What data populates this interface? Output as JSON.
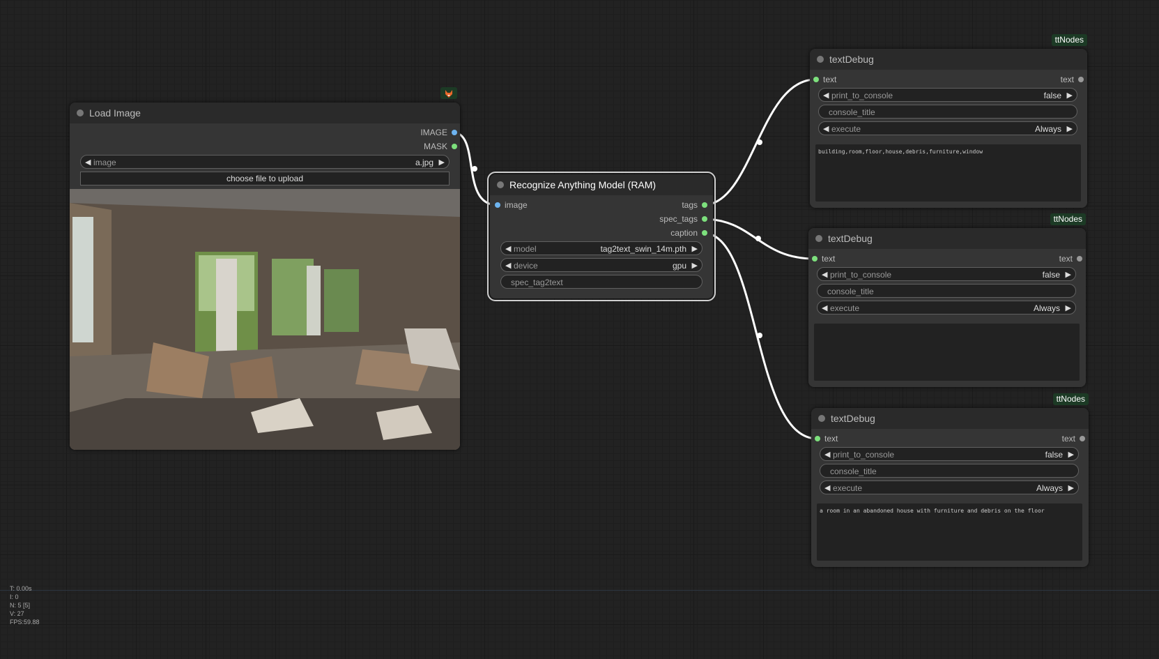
{
  "load_image": {
    "title": "Load Image",
    "outputs": [
      "IMAGE",
      "MASK"
    ],
    "image_widget": {
      "name": "image",
      "value": "a.jpg"
    },
    "upload_label": "choose file to upload",
    "badge_icon": "fox-icon"
  },
  "ram": {
    "title": "Recognize Anything Model (RAM)",
    "input": "image",
    "outputs": [
      "tags",
      "spec_tags",
      "caption"
    ],
    "model": {
      "name": "model",
      "value": "tag2text_swin_14m.pth"
    },
    "device": {
      "name": "device",
      "value": "gpu"
    },
    "spec_text": "spec_tag2text"
  },
  "debug_nodes": [
    {
      "badge": "ttNodes",
      "title": "textDebug",
      "input": "text",
      "output": "text",
      "print_name": "print_to_console",
      "print_value": "false",
      "console_title": "console_title",
      "execute_name": "execute",
      "execute_value": "Always",
      "text": "building,room,floor,house,debris,furniture,window"
    },
    {
      "badge": "ttNodes",
      "title": "textDebug",
      "input": "text",
      "output": "text",
      "print_name": "print_to_console",
      "print_value": "false",
      "console_title": "console_title",
      "execute_name": "execute",
      "execute_value": "Always",
      "text": ""
    },
    {
      "badge": "ttNodes",
      "title": "textDebug",
      "input": "text",
      "output": "text",
      "print_name": "print_to_console",
      "print_value": "false",
      "console_title": "console_title",
      "execute_name": "execute",
      "execute_value": "Always",
      "text": "a room in an abandoned house with furniture and debris on the floor"
    }
  ],
  "stats": {
    "t": "T: 0.00s",
    "i": "I: 0",
    "n": "N: 5 [5]",
    "v": "V: 27",
    "fps": "FPS:59.88"
  },
  "colors": {
    "image_slot": "#6eb4f0",
    "string_slot": "#7de07d",
    "badge_bg": "#1c3a25",
    "wire": "#ffffff"
  }
}
